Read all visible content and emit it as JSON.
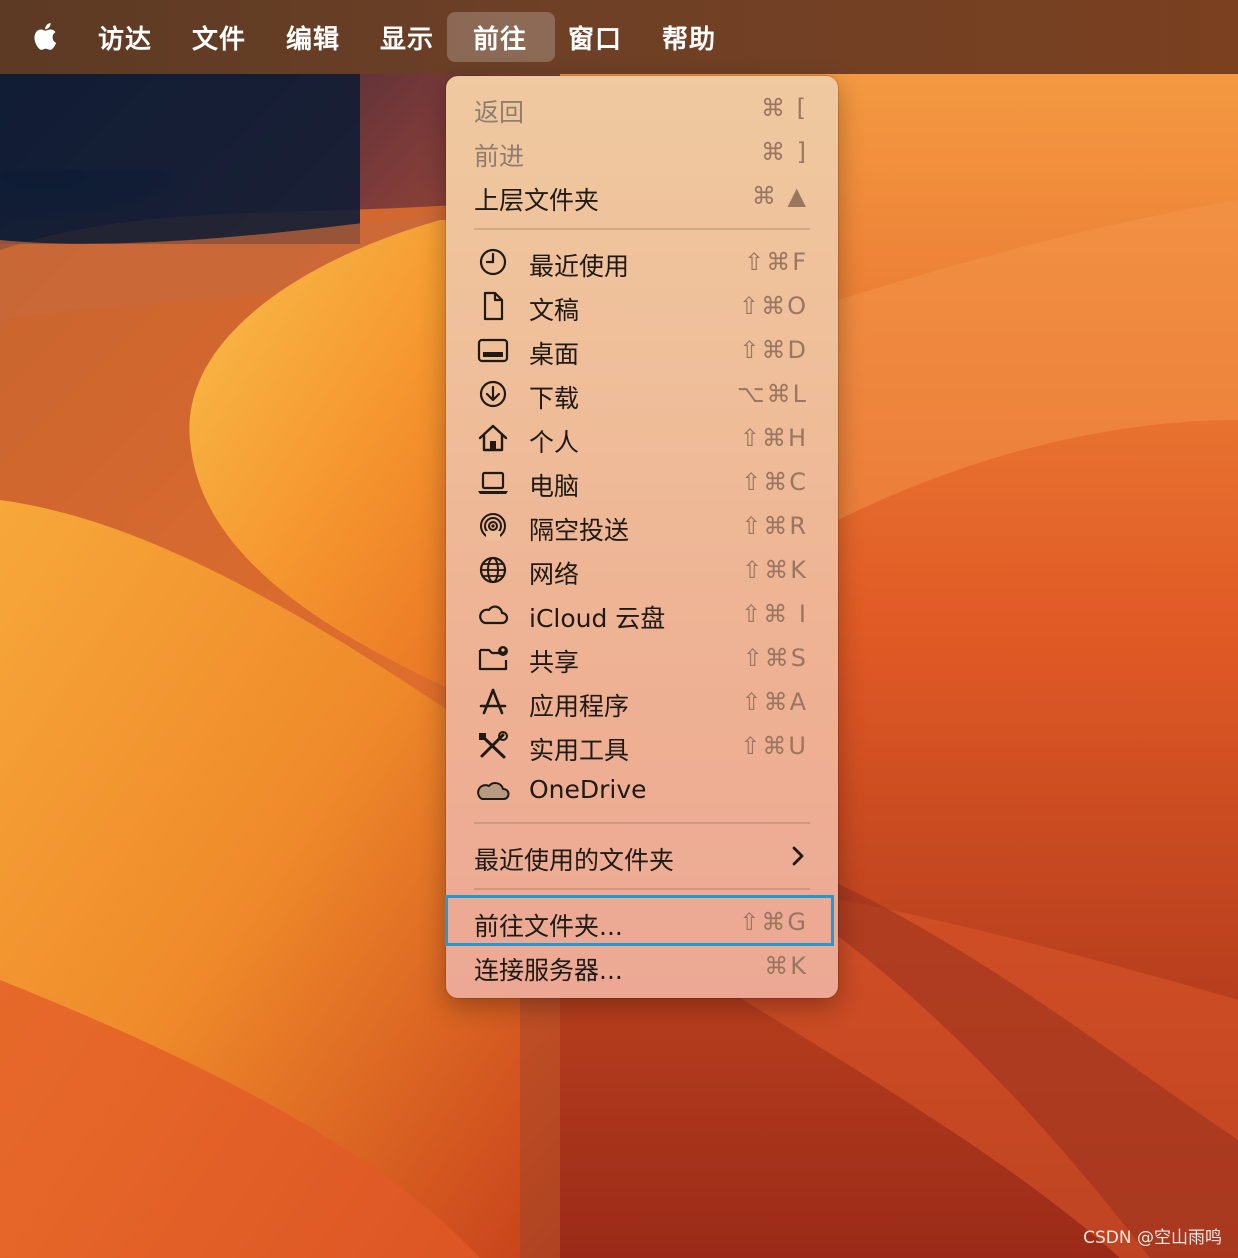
{
  "menubar": {
    "apple_icon": "apple-logo-icon",
    "items": [
      {
        "label": "访达"
      },
      {
        "label": "文件"
      },
      {
        "label": "编辑"
      },
      {
        "label": "显示"
      },
      {
        "label": "前往",
        "active": true
      },
      {
        "label": "窗口"
      },
      {
        "label": "帮助"
      }
    ]
  },
  "menu": {
    "nav": [
      {
        "label": "返回",
        "shortcut": "⌘ [",
        "disabled": true
      },
      {
        "label": "前进",
        "shortcut": "⌘ ]",
        "disabled": true
      },
      {
        "label": "上层文件夹",
        "shortcut": "⌘ ▲",
        "disabled": false
      }
    ],
    "places": [
      {
        "label": "最近使用",
        "shortcut": "⇧⌘F",
        "icon": "clock-icon"
      },
      {
        "label": "文稿",
        "shortcut": "⇧⌘O",
        "icon": "document-icon"
      },
      {
        "label": "桌面",
        "shortcut": "⇧⌘D",
        "icon": "desktop-icon"
      },
      {
        "label": "下载",
        "shortcut": "⌥⌘L",
        "icon": "download-icon"
      },
      {
        "label": "个人",
        "shortcut": "⇧⌘H",
        "icon": "home-icon"
      },
      {
        "label": "电脑",
        "shortcut": "⇧⌘C",
        "icon": "laptop-icon"
      },
      {
        "label": "隔空投送",
        "shortcut": "⇧⌘R",
        "icon": "airdrop-icon"
      },
      {
        "label": "网络",
        "shortcut": "⇧⌘K",
        "icon": "globe-icon"
      },
      {
        "label": "iCloud 云盘",
        "shortcut": "⇧⌘ I",
        "icon": "icloud-icon"
      },
      {
        "label": "共享",
        "shortcut": "⇧⌘S",
        "icon": "shared-folder-icon"
      },
      {
        "label": "应用程序",
        "shortcut": "⇧⌘A",
        "icon": "applications-icon"
      },
      {
        "label": "实用工具",
        "shortcut": "⇧⌘U",
        "icon": "utilities-icon"
      },
      {
        "label": "OneDrive",
        "shortcut": "",
        "icon": "onedrive-cloud-icon"
      }
    ],
    "recent_folders": {
      "label": "最近使用的文件夹",
      "icon": "chevron-right-icon"
    },
    "goto": [
      {
        "label": "前往文件夹...",
        "shortcut": "⇧⌘G",
        "highlighted": true
      },
      {
        "label": "连接服务器...",
        "shortcut": "⌘K"
      }
    ]
  },
  "watermark": "CSDN @空山雨鸣",
  "colors": {
    "highlight_border": "#1f9ad8",
    "menubar": "#6e4026",
    "text": "#1f1a16",
    "shortcut": "#9a7660"
  }
}
